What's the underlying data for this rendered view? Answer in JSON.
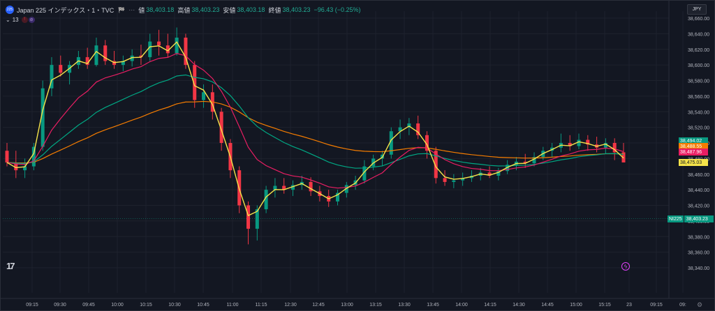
{
  "header": {
    "symbol_badge": "225",
    "title": "Japan 225 インデックス・1・TVC",
    "flag": "🏁",
    "dots": "⋯",
    "open_label": "値",
    "open_value": "38,403.18",
    "high_label": "高値",
    "high_value": "38,403.23",
    "low_label": "安値",
    "low_value": "38,403.18",
    "close_label": "終値",
    "close_value": "38,403.23",
    "change_value": "−96.43 (−0.25%)"
  },
  "indicators": {
    "collapse_label": "13",
    "badge1": "!",
    "badge2": "⊘"
  },
  "currency": "JPY",
  "price_tags": [
    {
      "value": "38,494.02",
      "bg": "#089981",
      "fg": "#ffffff"
    },
    {
      "value": "38,488.55",
      "bg": "#f57c00",
      "fg": "#ffffff"
    },
    {
      "value": "38,487.96",
      "bg": "#e91e63",
      "fg": "#ffffff"
    },
    {
      "value": "38,475.03",
      "bg": "#f5e44a",
      "fg": "#131722"
    }
  ],
  "nikkei_tag": {
    "symbol": "NI225",
    "value": "38,403.23"
  },
  "logo": "17",
  "bolt": "ϟ",
  "settings": "⚙",
  "colors": {
    "up": "#089981",
    "down": "#f23645",
    "ema_fast": "#f5e44a",
    "ema_mid": "#e91e63",
    "ema_slow": "#00a884",
    "ema_long": "#f57c00"
  },
  "chart_data": {
    "type": "candlestick",
    "y_ticks": [
      "38,660.00",
      "38,640.00",
      "38,620.00",
      "38,600.00",
      "38,580.00",
      "38,560.00",
      "38,540.00",
      "38,520.00",
      "38,500.00",
      "38,480.00",
      "38,460.00",
      "38,440.00",
      "38,420.00",
      "38,400.00",
      "38,380.00",
      "38,360.00",
      "38,340.00"
    ],
    "ylim": [
      38340,
      38660
    ],
    "x_ticks": [
      "09:15",
      "09:30",
      "09:45",
      "10:00",
      "10:15",
      "10:30",
      "10:45",
      "11:00",
      "11:15",
      "12:30",
      "12:45",
      "13:00",
      "13:15",
      "13:30",
      "13:45",
      "14:00",
      "14:15",
      "14:30",
      "14:45",
      "15:00",
      "15:15",
      "23",
      "09:15",
      "09:"
    ],
    "ohlc": [
      {
        "t": 0,
        "o": 38490,
        "h": 38500,
        "l": 38470,
        "c": 38475
      },
      {
        "t": 1,
        "o": 38475,
        "h": 38490,
        "l": 38455,
        "c": 38465
      },
      {
        "t": 2,
        "o": 38465,
        "h": 38480,
        "l": 38455,
        "c": 38470
      },
      {
        "t": 3,
        "o": 38470,
        "h": 38500,
        "l": 38465,
        "c": 38495
      },
      {
        "t": 4,
        "o": 38495,
        "h": 38580,
        "l": 38490,
        "c": 38570
      },
      {
        "t": 5,
        "o": 38570,
        "h": 38610,
        "l": 38560,
        "c": 38600
      },
      {
        "t": 6,
        "o": 38600,
        "h": 38612,
        "l": 38585,
        "c": 38590
      },
      {
        "t": 7,
        "o": 38590,
        "h": 38605,
        "l": 38575,
        "c": 38600
      },
      {
        "t": 8,
        "o": 38600,
        "h": 38618,
        "l": 38595,
        "c": 38610
      },
      {
        "t": 9,
        "o": 38610,
        "h": 38622,
        "l": 38595,
        "c": 38600
      },
      {
        "t": 10,
        "o": 38600,
        "h": 38635,
        "l": 38598,
        "c": 38625
      },
      {
        "t": 11,
        "o": 38625,
        "h": 38632,
        "l": 38600,
        "c": 38605
      },
      {
        "t": 12,
        "o": 38605,
        "h": 38618,
        "l": 38595,
        "c": 38600
      },
      {
        "t": 13,
        "o": 38600,
        "h": 38612,
        "l": 38592,
        "c": 38605
      },
      {
        "t": 14,
        "o": 38605,
        "h": 38620,
        "l": 38598,
        "c": 38612
      },
      {
        "t": 15,
        "o": 38612,
        "h": 38626,
        "l": 38600,
        "c": 38610
      },
      {
        "t": 16,
        "o": 38610,
        "h": 38640,
        "l": 38605,
        "c": 38630
      },
      {
        "t": 17,
        "o": 38630,
        "h": 38645,
        "l": 38612,
        "c": 38625
      },
      {
        "t": 18,
        "o": 38625,
        "h": 38640,
        "l": 38610,
        "c": 38615
      },
      {
        "t": 19,
        "o": 38615,
        "h": 38648,
        "l": 38612,
        "c": 38635
      },
      {
        "t": 20,
        "o": 38635,
        "h": 38640,
        "l": 38595,
        "c": 38600
      },
      {
        "t": 21,
        "o": 38600,
        "h": 38605,
        "l": 38545,
        "c": 38555
      },
      {
        "t": 22,
        "o": 38555,
        "h": 38575,
        "l": 38545,
        "c": 38565
      },
      {
        "t": 23,
        "o": 38565,
        "h": 38575,
        "l": 38530,
        "c": 38540
      },
      {
        "t": 24,
        "o": 38540,
        "h": 38545,
        "l": 38490,
        "c": 38500
      },
      {
        "t": 25,
        "o": 38500,
        "h": 38505,
        "l": 38455,
        "c": 38465
      },
      {
        "t": 26,
        "o": 38465,
        "h": 38470,
        "l": 38410,
        "c": 38420
      },
      {
        "t": 27,
        "o": 38420,
        "h": 38425,
        "l": 38370,
        "c": 38390
      },
      {
        "t": 28,
        "o": 38390,
        "h": 38420,
        "l": 38375,
        "c": 38415
      },
      {
        "t": 29,
        "o": 38415,
        "h": 38445,
        "l": 38410,
        "c": 38440
      },
      {
        "t": 30,
        "o": 38440,
        "h": 38455,
        "l": 38430,
        "c": 38445
      },
      {
        "t": 31,
        "o": 38445,
        "h": 38455,
        "l": 38435,
        "c": 38440
      },
      {
        "t": 32,
        "o": 38440,
        "h": 38452,
        "l": 38432,
        "c": 38446
      },
      {
        "t": 33,
        "o": 38446,
        "h": 38458,
        "l": 38440,
        "c": 38450
      },
      {
        "t": 34,
        "o": 38450,
        "h": 38456,
        "l": 38432,
        "c": 38438
      },
      {
        "t": 35,
        "o": 38438,
        "h": 38445,
        "l": 38425,
        "c": 38432
      },
      {
        "t": 36,
        "o": 38432,
        "h": 38440,
        "l": 38418,
        "c": 38425
      },
      {
        "t": 37,
        "o": 38425,
        "h": 38440,
        "l": 38420,
        "c": 38436
      },
      {
        "t": 38,
        "o": 38436,
        "h": 38450,
        "l": 38430,
        "c": 38446
      },
      {
        "t": 39,
        "o": 38446,
        "h": 38458,
        "l": 38440,
        "c": 38452
      },
      {
        "t": 40,
        "o": 38452,
        "h": 38478,
        "l": 38448,
        "c": 38470
      },
      {
        "t": 41,
        "o": 38470,
        "h": 38485,
        "l": 38465,
        "c": 38480
      },
      {
        "t": 42,
        "o": 38480,
        "h": 38490,
        "l": 38470,
        "c": 38485
      },
      {
        "t": 43,
        "o": 38485,
        "h": 38520,
        "l": 38480,
        "c": 38515
      },
      {
        "t": 44,
        "o": 38515,
        "h": 38530,
        "l": 38505,
        "c": 38520
      },
      {
        "t": 45,
        "o": 38520,
        "h": 38532,
        "l": 38510,
        "c": 38525
      },
      {
        "t": 46,
        "o": 38525,
        "h": 38535,
        "l": 38505,
        "c": 38510
      },
      {
        "t": 47,
        "o": 38510,
        "h": 38515,
        "l": 38480,
        "c": 38490
      },
      {
        "t": 48,
        "o": 38490,
        "h": 38495,
        "l": 38448,
        "c": 38455
      },
      {
        "t": 49,
        "o": 38455,
        "h": 38465,
        "l": 38445,
        "c": 38450
      },
      {
        "t": 50,
        "o": 38450,
        "h": 38460,
        "l": 38442,
        "c": 38452
      },
      {
        "t": 51,
        "o": 38452,
        "h": 38462,
        "l": 38445,
        "c": 38455
      },
      {
        "t": 52,
        "o": 38455,
        "h": 38465,
        "l": 38450,
        "c": 38458
      },
      {
        "t": 53,
        "o": 38458,
        "h": 38468,
        "l": 38452,
        "c": 38462
      },
      {
        "t": 54,
        "o": 38462,
        "h": 38470,
        "l": 38455,
        "c": 38458
      },
      {
        "t": 55,
        "o": 38458,
        "h": 38468,
        "l": 38452,
        "c": 38464
      },
      {
        "t": 56,
        "o": 38464,
        "h": 38478,
        "l": 38460,
        "c": 38472
      },
      {
        "t": 57,
        "o": 38472,
        "h": 38482,
        "l": 38465,
        "c": 38476
      },
      {
        "t": 58,
        "o": 38476,
        "h": 38486,
        "l": 38468,
        "c": 38474
      },
      {
        "t": 59,
        "o": 38474,
        "h": 38488,
        "l": 38470,
        "c": 38482
      },
      {
        "t": 60,
        "o": 38482,
        "h": 38495,
        "l": 38478,
        "c": 38490
      },
      {
        "t": 61,
        "o": 38490,
        "h": 38500,
        "l": 38482,
        "c": 38494
      },
      {
        "t": 62,
        "o": 38494,
        "h": 38512,
        "l": 38488,
        "c": 38500
      },
      {
        "t": 63,
        "o": 38500,
        "h": 38510,
        "l": 38490,
        "c": 38496
      },
      {
        "t": 64,
        "o": 38496,
        "h": 38512,
        "l": 38492,
        "c": 38504
      },
      {
        "t": 65,
        "o": 38504,
        "h": 38510,
        "l": 38490,
        "c": 38498
      },
      {
        "t": 66,
        "o": 38498,
        "h": 38508,
        "l": 38488,
        "c": 38494
      },
      {
        "t": 67,
        "o": 38494,
        "h": 38506,
        "l": 38486,
        "c": 38500
      },
      {
        "t": 68,
        "o": 38500,
        "h": 38506,
        "l": 38478,
        "c": 38488
      },
      {
        "t": 69,
        "o": 38488,
        "h": 38500,
        "l": 38480,
        "c": 38475
      }
    ]
  }
}
